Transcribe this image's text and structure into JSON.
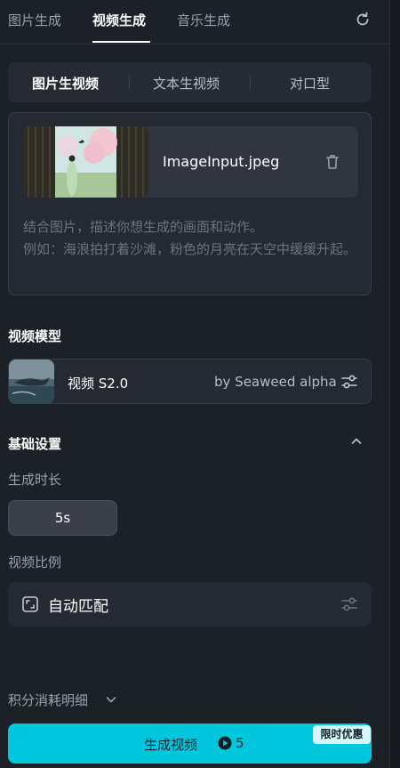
{
  "tabs": [
    {
      "label": "图片生成"
    },
    {
      "label": "视频生成"
    },
    {
      "label": "音乐生成"
    }
  ],
  "active_tab": "视频生成",
  "modes": [
    {
      "label": "图片生视频"
    },
    {
      "label": "文本生视频"
    },
    {
      "label": "对口型"
    }
  ],
  "active_mode": "图片生视频",
  "upload": {
    "file_name": "ImageInput.jpeg",
    "prompt_placeholder": "结合图片，描述你想生成的画面和动作。\n例如：海浪拍打着沙滩，粉色的月亮在天空中缓缓升起。"
  },
  "model": {
    "section_title": "视频模型",
    "name": "视频 S2.0",
    "provider": "by Seaweed alpha"
  },
  "basic": {
    "section_title": "基础设置",
    "duration_label": "生成时长",
    "duration_value": "5s",
    "ratio_label": "视频比例",
    "ratio_value": "自动匹配"
  },
  "footer": {
    "credits_link": "积分消耗明细",
    "generate_label": "生成视频",
    "credit_cost": "5",
    "promo_badge": "限时优惠"
  },
  "colors": {
    "background": "#1c2027",
    "accent": "#00c6de"
  }
}
